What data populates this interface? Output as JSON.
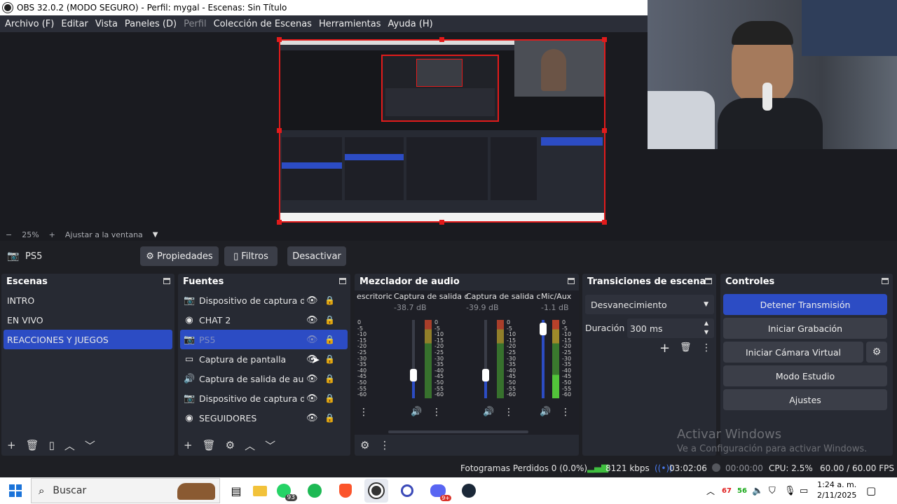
{
  "window": {
    "title": "OBS 32.0.2 (MODO SEGURO) - Perfil: mygal - Escenas: Sin Título"
  },
  "menu": [
    "Archivo (F)",
    "Editar",
    "Vista",
    "Paneles (D)",
    "Perfil",
    "Colección de Escenas",
    "Herramientas",
    "Ayuda (H)"
  ],
  "zoom": {
    "minus": "−",
    "value": "25%",
    "plus": "+",
    "fit": "Ajustar a la ventana"
  },
  "source_bar": {
    "name": "PS5",
    "properties": "Propiedades",
    "filters": "Filtros",
    "deactivate": "Desactivar"
  },
  "scenes": {
    "title": "Escenas",
    "items": [
      "INTRO",
      "EN VIVO",
      "REACCIONES Y JUEGOS"
    ],
    "selected": 2
  },
  "sources": {
    "title": "Fuentes",
    "items": [
      {
        "label": "Dispositivo de captura de v",
        "icon": "camera-icon"
      },
      {
        "label": "CHAT 2",
        "icon": "globe-icon"
      },
      {
        "label": "PS5",
        "icon": "camera-icon"
      },
      {
        "label": "Captura de pantalla",
        "icon": "monitor-icon"
      },
      {
        "label": "Captura de salida de audio",
        "icon": "speaker-icon"
      },
      {
        "label": "Dispositivo de captura de v",
        "icon": "camera-icon"
      },
      {
        "label": "SEGUIDORES",
        "icon": "globe-icon"
      }
    ],
    "selected": 2
  },
  "mixer": {
    "title": "Mezclador de audio",
    "channels": [
      {
        "name": "escritoric",
        "db": ""
      },
      {
        "name": "Captura de salida c",
        "db": "-38.7 dB"
      },
      {
        "name": "Captura de salida c",
        "db": "-39.9 dB"
      },
      {
        "name": "Mic/Aux",
        "db": "-1.1 dB"
      }
    ],
    "scale": [
      "0",
      "-5",
      "-10",
      "-15",
      "-20",
      "-25",
      "-30",
      "-35",
      "-40",
      "-45",
      "-50",
      "-55",
      "-60"
    ]
  },
  "transitions": {
    "title": "Transiciones de escena",
    "type": "Desvanecimiento",
    "duration_label": "Duración",
    "duration_value": "300 ms"
  },
  "controls": {
    "title": "Controles",
    "stop_stream": "Detener Transmisión",
    "start_recording": "Iniciar Grabación",
    "start_virtual_cam": "Iniciar Cámara Virtual",
    "studio_mode": "Modo Estudio",
    "settings": "Ajustes"
  },
  "watermark": {
    "line1": "Activar Windows",
    "line2": "Ve a Configuración para activar Windows."
  },
  "status": {
    "dropped_frames": "Fotogramas Perdidos 0 (0.0%)",
    "bitrate": "8121 kbps",
    "stream_time": "03:02:06",
    "rec_time": "00:00:00",
    "cpu": "CPU: 2.5%",
    "fps": "60.00 / 60.00 FPS"
  },
  "taskbar": {
    "search_placeholder": "Buscar",
    "whatsapp_badge": "93",
    "discord_badge": "9+",
    "net_down": "67",
    "net_up": "56",
    "time": "1:24 a. m.",
    "date": "2/11/2025"
  },
  "colors": {
    "accent": "#2c4cc4",
    "preview_border": "#e21b1b",
    "bg": "#1e1f24"
  }
}
